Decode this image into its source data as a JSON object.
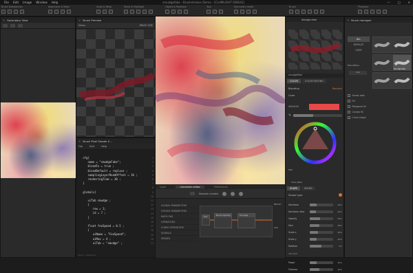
{
  "menu": {
    "items": [
      "File",
      "Edit",
      "Image",
      "Window",
      "Help"
    ],
    "title": "smudgefake - Brushstrokes Demo - [CLAMLIGHT DEBUG]",
    "window_controls": [
      "—",
      "□",
      "✕"
    ]
  },
  "toolbar": {
    "groups": [
      {
        "label": "Brush Deselection",
        "icons": 4
      },
      {
        "label": "Alignment & Mask",
        "icons": 4
      },
      {
        "label": "Undo & Redo",
        "icons": 3
      },
      {
        "label": "Show & Highlight",
        "icons": 5
      },
      {
        "label": "Object & Positions",
        "icons": 4
      },
      {
        "label": "Tool",
        "icons": 3
      },
      {
        "label": "Symmetry mode",
        "icons": 4
      },
      {
        "label": "Brush",
        "icons": 6
      },
      {
        "label": "Pixelwise",
        "icons": 5
      }
    ]
  },
  "secondary_view": {
    "title": "Secondary View"
  },
  "brush_preview": {
    "title": "Brush Preview",
    "view_label": "Views",
    "size_label": "BRUSH SIZE"
  },
  "shader_editor": {
    "title": "Brush Pixel Shader E...",
    "menu": [
      "File",
      "Edit",
      "Help"
    ],
    "lines": [
      "   cfg{",
      "      name = \"smudgeFake\";",
      "      blendFx = true ;",
      "      blendDefault = replace ;",
      "      samplingLayerReadOffset = 16 ;",
      "      renderingTime = 30 ;",
      "   }",
      "",
      "   globals{",
      "",
      "      uiTab smudge ;",
      "      {",
      "         row = 1;",
      "         id = 7 ;",
      "      }",
      "",
      "      float fooSpeed = 0.5 ;",
      "      {",
      "         uiName = \"FooSpeed\";",
      "         uiMax = 4 ;",
      "         uiTab = \"smudge\" ;"
    ],
    "line_numbers": [
      "1",
      "2",
      "3",
      "4",
      "5",
      "6",
      "7",
      "8",
      "9",
      "10",
      "11",
      "12",
      "13",
      "14",
      "15",
      "16",
      "17",
      "18",
      "19",
      "20",
      "21"
    ],
    "status": "Line 1 - Column 1"
  },
  "canvas": {
    "tabs": [
      "Layer",
      "Controller editor",
      "Preferences"
    ],
    "active_tab": "Controller editor"
  },
  "controller_editor": {
    "toolbar_label": "Network created",
    "categories": [
      "GLOBAL PARAMETERS",
      "STROKE PARAMETERS",
      "MATH FNS",
      "OPERATORS",
      "CURVE OPERATORS",
      "SIGNALS",
      "SENSES"
    ],
    "nodes": [
      {
        "title": "Brush Opacity"
      },
      {
        "title": "Smudge"
      },
      {
        "title": "Out"
      }
    ],
    "right_labels": [
      "BRUSH",
      "Size"
    ]
  },
  "brush_properties": {
    "top_title": "Smudge ritter",
    "brush_name": "smudgeFake",
    "tabs": [
      "COLOR",
      "COLOR EDITING"
    ],
    "blending_label": "Blending",
    "blending_value": "Replace",
    "color_section": "Color",
    "color_hex": "#EA4245",
    "color_swatch": "#e84848",
    "opacity_label": "Opacity",
    "hsv_label": "HSV",
    "color_jitter": "Color Jitter",
    "shape_tabs": [
      "SHAPE",
      "BLEND"
    ],
    "shape_type": "Shape type",
    "params": [
      {
        "name": "Hardness",
        "value": "20%",
        "fill": 0.3
      },
      {
        "name": "Hardness ratio",
        "value": "20%",
        "fill": 0.25
      },
      {
        "name": "Opacity",
        "value": "45%",
        "fill": 0.45
      },
      {
        "name": "Size",
        "value": "40%",
        "fill": 0.4
      },
      {
        "name": "Scale x",
        "value": "30%",
        "fill": 0.35
      },
      {
        "name": "Scale y",
        "value": "20%",
        "fill": 0.3
      },
      {
        "name": "Rotation",
        "value": "0%",
        "fill": 0.5
      }
    ],
    "bottom_section": "SMUDGE",
    "bottom_params": [
      {
        "name": "Power",
        "value": "30%",
        "fill": 0.3
      },
      {
        "name": "Flatness",
        "value": "40%",
        "fill": 0.4
      }
    ]
  },
  "brush_manager": {
    "title": "Brush manager",
    "categories": [
      "ALL",
      "DEFAULT",
      "USER"
    ],
    "more_label": "More filters",
    "add_label": "Add",
    "filters": [
      "Smear dots",
      "Fill",
      "Polygonal fill",
      "Central fill",
      "Curve shape"
    ],
    "thumb_labels": [
      "",
      "",
      "",
      "Smudge-fake",
      "",
      ""
    ]
  }
}
